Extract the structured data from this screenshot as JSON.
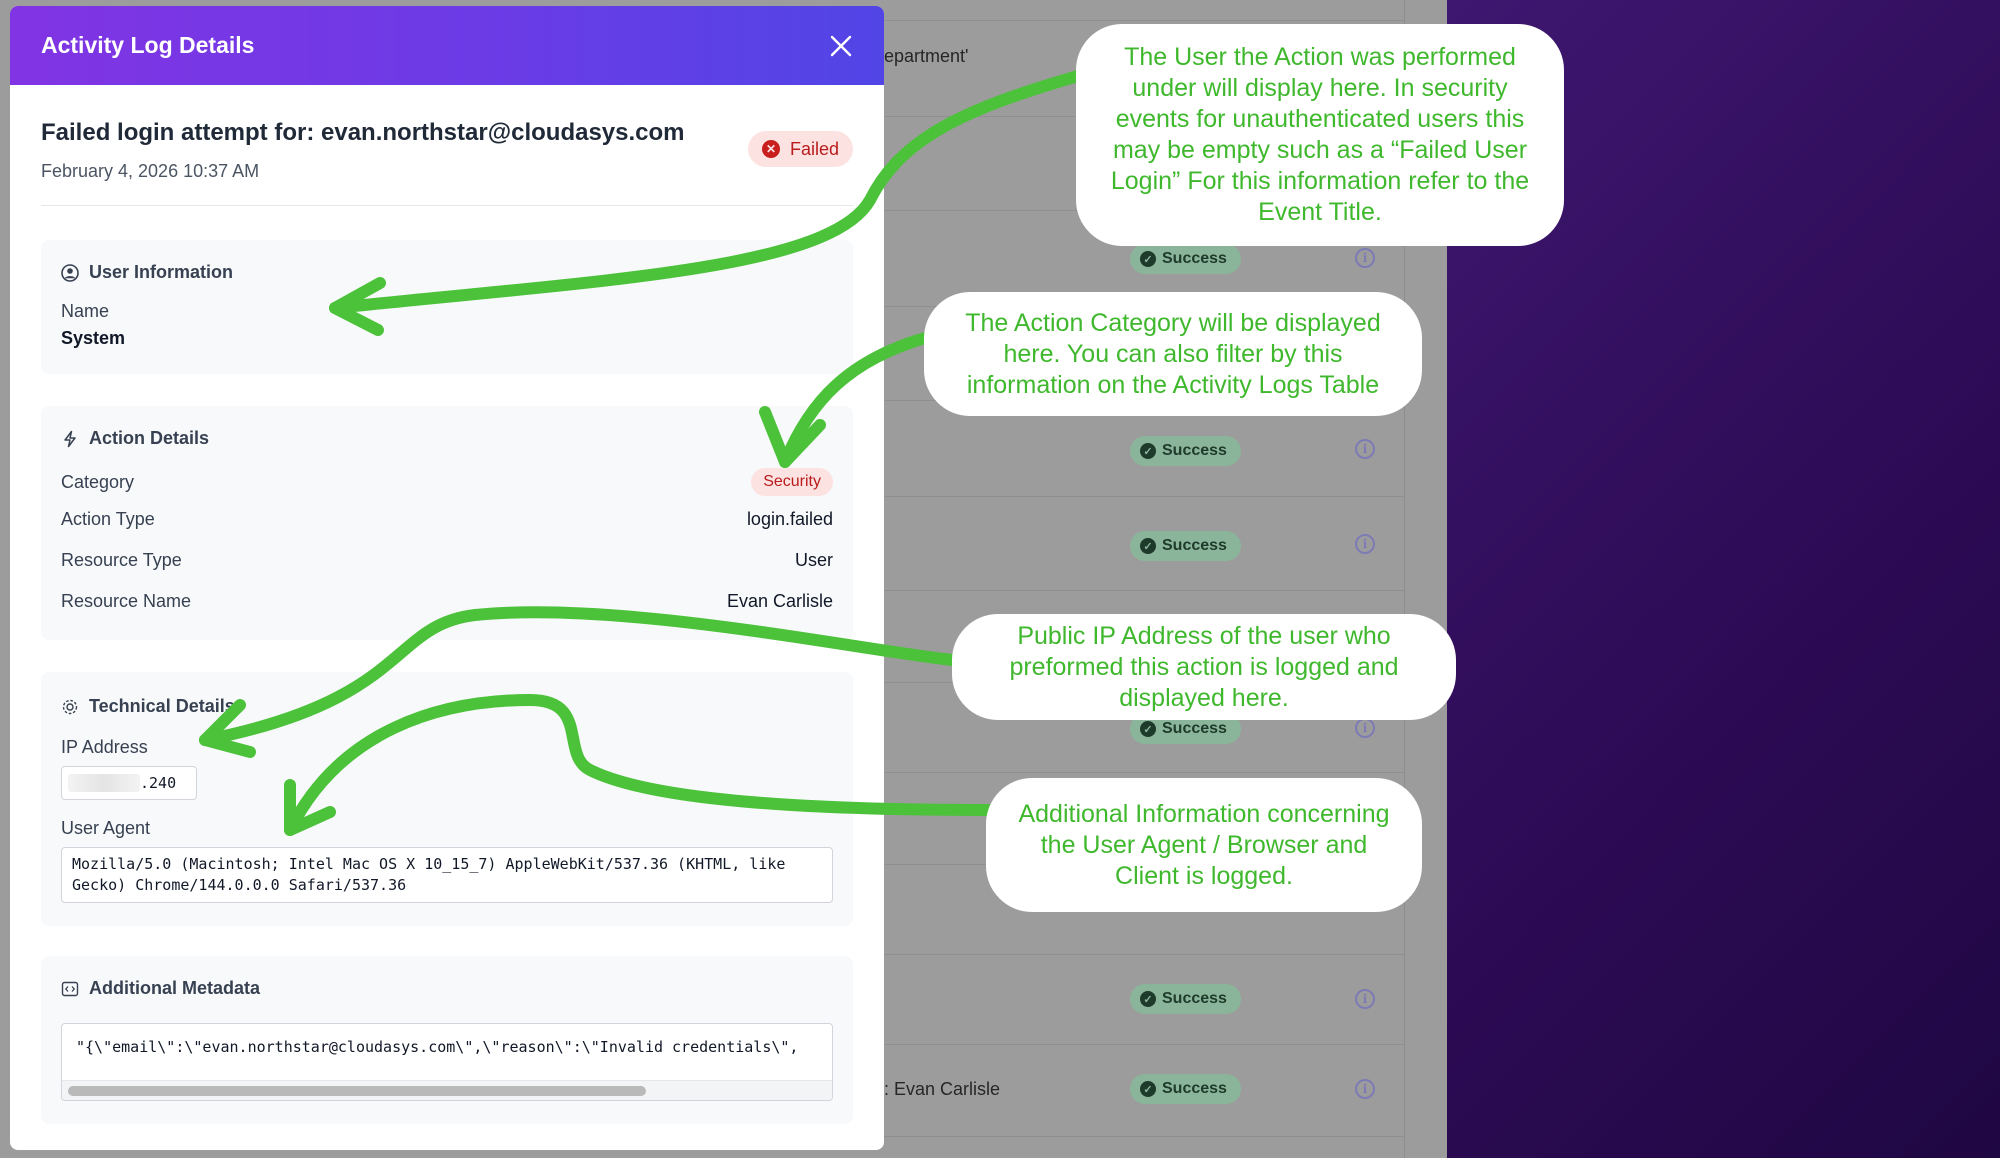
{
  "background": {
    "partial_texts": [
      "epartment'",
      ": Evan Carlisle"
    ],
    "status_label": "Success"
  },
  "modal": {
    "title": "Activity Log Details",
    "event_title": "Failed login attempt for: evan.northstar@cloudasys.com",
    "event_date": "February 4, 2026 10:37 AM",
    "status": "Failed",
    "user_info": {
      "heading": "User Information",
      "name_label": "Name",
      "name_value": "System"
    },
    "action_details": {
      "heading": "Action Details",
      "category_label": "Category",
      "category_value": "Security",
      "action_type_label": "Action Type",
      "action_type_value": "login.failed",
      "resource_type_label": "Resource Type",
      "resource_type_value": "User",
      "resource_name_label": "Resource Name",
      "resource_name_value": "Evan Carlisle"
    },
    "technical_details": {
      "heading": "Technical Details",
      "ip_label": "IP Address",
      "ip_value": ".240",
      "ua_label": "User Agent",
      "ua_value": "Mozilla/5.0 (Macintosh; Intel Mac OS X 10_15_7) AppleWebKit/537.36 (KHTML, like Gecko) Chrome/144.0.0.0 Safari/537.36"
    },
    "metadata": {
      "heading": "Additional Metadata",
      "value": "\"{\\\"email\\\":\\\"evan.northstar@cloudasys.com\\\",\\\"reason\\\":\\\"Invalid credentials\\\","
    }
  },
  "annotations": {
    "user": "The User the Action was performed under will display here. In security events for unauthenticated users this may be empty such as a “Failed User Login” For this information refer to the Event Title.",
    "category": "The Action Category will be displayed here. You can also filter by this information on the Activity Logs Table",
    "ip": "Public IP Address of the user who preformed this action is logged and displayed here.",
    "agent": "Additional Information concerning the User Agent / Browser and Client is logged."
  },
  "colors": {
    "header_start": "#8134e3",
    "header_end": "#5145e6",
    "annotation_green": "#3fb82d",
    "failed_red": "#b91c1c"
  }
}
